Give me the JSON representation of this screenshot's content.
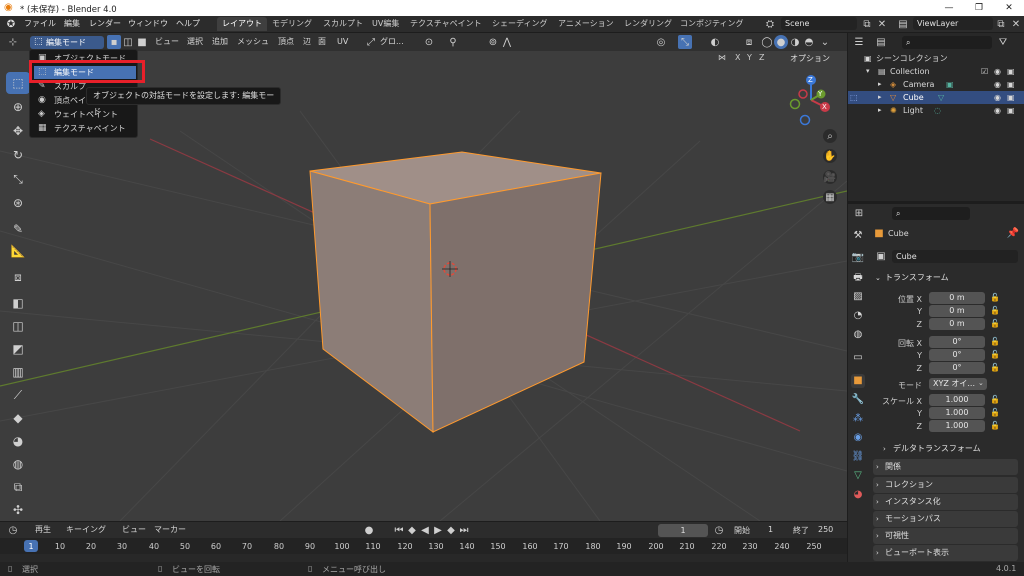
{
  "window": {
    "title": "* (未保存) - Blender 4.0",
    "controls": [
      "—",
      "❐",
      "✕"
    ]
  },
  "topbar": {
    "menus": [
      "ファイル",
      "編集",
      "レンダー",
      "ウィンドウ",
      "ヘルプ"
    ],
    "workspaces": [
      "レイアウト",
      "モデリング",
      "スカルプト",
      "UV編集",
      "テクスチャペイント",
      "シェーディング",
      "アニメーション",
      "レンダリング",
      "コンポジティング"
    ],
    "active_workspace": "レイアウト",
    "scene": "Scene",
    "view_layer": "ViewLayer"
  },
  "viewport_header": {
    "mode": "編集モード",
    "menus": [
      "ビュー",
      "選択",
      "追加",
      "メッシュ",
      "頂点",
      "辺",
      "面",
      "UV"
    ],
    "transform_orientation": "グロ...",
    "options_label": "オプション",
    "axes": [
      "X",
      "Y",
      "Z"
    ]
  },
  "mode_menu": {
    "items": [
      {
        "label": "オブジェクトモード",
        "icon": "▣"
      },
      {
        "label": "編集モード",
        "icon": "⬚"
      },
      {
        "label": "スカルプ...",
        "icon": "✎"
      },
      {
        "label": "頂点ペイ...",
        "icon": "◉"
      },
      {
        "label": "ウェイトペイント",
        "icon": "◈"
      },
      {
        "label": "テクスチャペイント",
        "icon": "▦"
      }
    ],
    "highlighted": "編集モード",
    "tooltip": "オブジェクトの対話モードを設定します: 編集モード"
  },
  "gizmo": {
    "x": "X",
    "y": "Y",
    "z": "Z"
  },
  "outliner": {
    "title": "シーンコレクション",
    "collection": "Collection",
    "items": [
      {
        "label": "Camera",
        "icon": "🎥",
        "selected": false
      },
      {
        "label": "Cube",
        "icon": "▽",
        "selected": true
      },
      {
        "label": "Light",
        "icon": "💡",
        "selected": false
      }
    ]
  },
  "properties": {
    "object_name": "Cube",
    "data_name": "Cube",
    "transform_section": "トランスフォーム",
    "location_label": "位置 X",
    "location": [
      "0 m",
      "0 m",
      "0 m"
    ],
    "rotation_label": "回転 X",
    "rotation": [
      "0°",
      "0°",
      "0°"
    ],
    "mode_label": "モード",
    "rotation_mode": "XYZ オイ...",
    "scale_label": "スケール X",
    "scale": [
      "1.000",
      "1.000",
      "1.000"
    ],
    "axis_y": "Y",
    "axis_z": "Z",
    "delta_section": "デルタトランスフォーム",
    "sections": [
      "関係",
      "コレクション",
      "インスタンス化",
      "モーションパス",
      "可視性",
      "ビューポート表示"
    ]
  },
  "timeline": {
    "menus": [
      "再生",
      "キーイング",
      "ビュー",
      "マーカー"
    ],
    "current_frame": "1",
    "start_label": "開始",
    "start": "1",
    "end_label": "終了",
    "end": "250",
    "ticks": [
      "1",
      "10",
      "20",
      "30",
      "40",
      "50",
      "60",
      "70",
      "80",
      "90",
      "100",
      "110",
      "120",
      "130",
      "140",
      "150",
      "160",
      "170",
      "180",
      "190",
      "200",
      "210",
      "220",
      "230",
      "240",
      "250"
    ]
  },
  "statusbar": {
    "select": "選択",
    "rotate": "ビューを回転",
    "menu": "メニュー呼び出し",
    "version": "4.0.1"
  },
  "colors": {
    "accent": "#4772b3",
    "cube_face": "#8e7e78",
    "cube_edge": "#ff9a2e",
    "highlight_red": "#e8202a"
  }
}
